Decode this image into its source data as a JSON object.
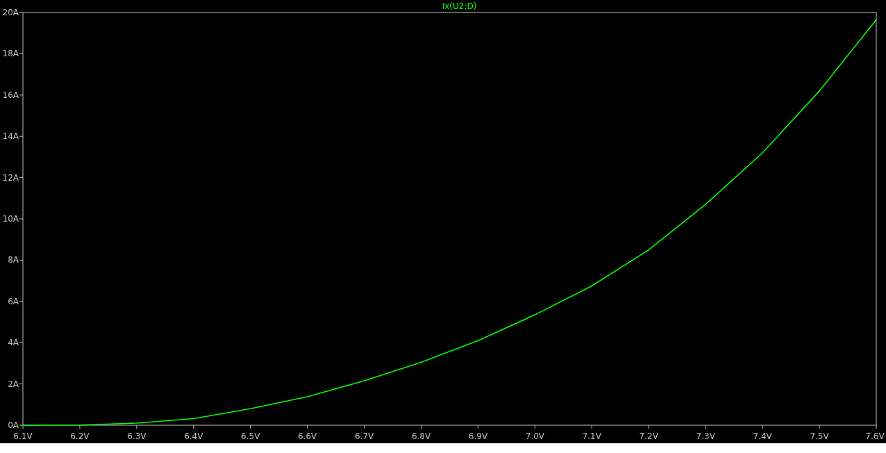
{
  "plot": {
    "chart_data": {
      "type": "line",
      "x": [
        6.1,
        6.2,
        6.3,
        6.4,
        6.5,
        6.6,
        6.7,
        6.8,
        6.9,
        7.0,
        7.1,
        7.2,
        7.3,
        7.4,
        7.5,
        7.6
      ],
      "series": [
        {
          "name": "Ix(U2:D)",
          "color": "#00ff00",
          "values": [
            0,
            0.01,
            0.1,
            0.32,
            0.8,
            1.38,
            2.15,
            3.05,
            4.1,
            5.35,
            6.75,
            8.5,
            10.7,
            13.2,
            16.2,
            19.65
          ]
        }
      ],
      "xlim": [
        6.1,
        7.6
      ],
      "ylim": [
        0,
        20
      ],
      "xticks": [
        {
          "value": 6.1,
          "label": "6.1V"
        },
        {
          "value": 6.2,
          "label": "6.2V"
        },
        {
          "value": 6.3,
          "label": "6.3V"
        },
        {
          "value": 6.4,
          "label": "6.4V"
        },
        {
          "value": 6.5,
          "label": "6.5V"
        },
        {
          "value": 6.6,
          "label": "6.6V"
        },
        {
          "value": 6.7,
          "label": "6.7V"
        },
        {
          "value": 6.8,
          "label": "6.8V"
        },
        {
          "value": 6.9,
          "label": "6.9V"
        },
        {
          "value": 7.0,
          "label": "7.0V"
        },
        {
          "value": 7.1,
          "label": "7.1V"
        },
        {
          "value": 7.2,
          "label": "7.2V"
        },
        {
          "value": 7.3,
          "label": "7.3V"
        },
        {
          "value": 7.4,
          "label": "7.4V"
        },
        {
          "value": 7.5,
          "label": "7.5V"
        },
        {
          "value": 7.6,
          "label": "7.6V"
        }
      ],
      "yticks": [
        {
          "value": 0,
          "label": "0A"
        },
        {
          "value": 2,
          "label": "2A"
        },
        {
          "value": 4,
          "label": "4A"
        },
        {
          "value": 6,
          "label": "6A"
        },
        {
          "value": 8,
          "label": "8A"
        },
        {
          "value": 10,
          "label": "10A"
        },
        {
          "value": 12,
          "label": "12A"
        },
        {
          "value": 14,
          "label": "14A"
        },
        {
          "value": 16,
          "label": "16A"
        },
        {
          "value": 18,
          "label": "18A"
        },
        {
          "value": 20,
          "label": "20A"
        }
      ]
    }
  }
}
